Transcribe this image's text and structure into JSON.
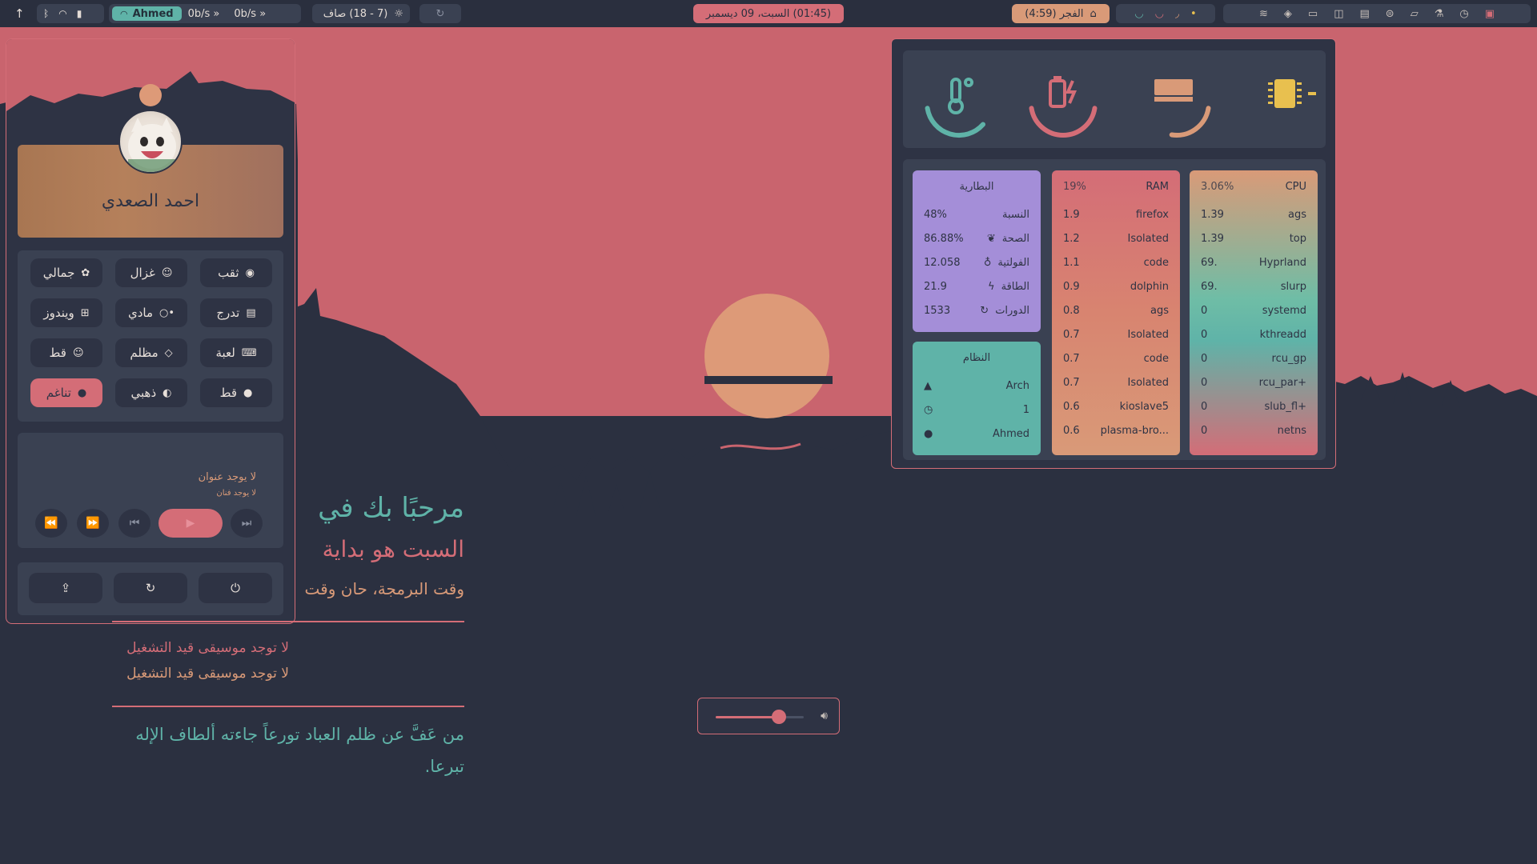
{
  "topbar": {
    "workspace_user": "Ahmed",
    "net_up": "0b/s",
    "net_down": "0b/s",
    "weather": "(7 - 18) صاف",
    "clock": "(01:45) السبت، 09 ديسمبر",
    "prayer": "الفجر (4:59)"
  },
  "profile": {
    "name": "احمد الصعدي"
  },
  "apps": [
    {
      "label": "ثقب",
      "icon": "steam-icon",
      "glyph": "◉"
    },
    {
      "label": "غزال",
      "icon": "ghost-icon",
      "glyph": "☺"
    },
    {
      "label": "جمالي",
      "icon": "palette-icon",
      "glyph": "✿"
    },
    {
      "label": "تدرج",
      "icon": "gradient-icon",
      "glyph": "▤"
    },
    {
      "label": "مادي",
      "icon": "toggle-icon",
      "glyph": "•○"
    },
    {
      "label": "ويندوز",
      "icon": "windows-icon",
      "glyph": "⊞"
    },
    {
      "label": "لعبة",
      "icon": "gamepad-icon",
      "glyph": "⌨"
    },
    {
      "label": "مظلم",
      "icon": "diamond-icon",
      "glyph": "◇"
    },
    {
      "label": "قط",
      "icon": "cat-icon",
      "glyph": "☺"
    },
    {
      "label": "قط",
      "icon": "circle-icon",
      "glyph": "●"
    },
    {
      "label": "ذهبي",
      "icon": "circle-half-icon",
      "glyph": "◐"
    },
    {
      "label": "تناغم",
      "icon": "circle-dot-icon",
      "glyph": "●"
    }
  ],
  "player": {
    "title": "لا يوجد عنوان",
    "artist": "لا يوجد فنان"
  },
  "welcome": {
    "line1": "مرحبًا بك في",
    "line2": "السبت هو بداية",
    "line3": "وقت البرمجة، حان وقت",
    "music1": "لا توجد موسيقى قيد التشغيل",
    "music2": "لا توجد موسيقى قيد التشغيل",
    "quote1": "من عَفَّ عن ظلم العباد تورعاً جاءته ألطاف الإله",
    "quote2": "تبرعا."
  },
  "cpu": {
    "header": "CPU",
    "value": "3.06%",
    "rows": [
      {
        "name": "ags",
        "val": "1.39"
      },
      {
        "name": "top",
        "val": "1.39"
      },
      {
        "name": "Hyprland",
        "val": "69."
      },
      {
        "name": "slurp",
        "val": "69."
      },
      {
        "name": "systemd",
        "val": "0"
      },
      {
        "name": "kthreadd",
        "val": "0"
      },
      {
        "name": "rcu_gp",
        "val": "0"
      },
      {
        "name": "rcu_par+",
        "val": "0"
      },
      {
        "name": "slub_fl+",
        "val": "0"
      },
      {
        "name": "netns",
        "val": "0"
      }
    ]
  },
  "ram": {
    "header": "RAM",
    "value": "19%",
    "rows": [
      {
        "name": "firefox",
        "val": "1.9"
      },
      {
        "name": "Isolated",
        "val": "1.2"
      },
      {
        "name": "code",
        "val": "1.1"
      },
      {
        "name": "dolphin",
        "val": "0.9"
      },
      {
        "name": "ags",
        "val": "0.8"
      },
      {
        "name": "Isolated",
        "val": "0.7"
      },
      {
        "name": "code",
        "val": "0.7"
      },
      {
        "name": "Isolated",
        "val": "0.7"
      },
      {
        "name": "kioslave5",
        "val": "0.6"
      },
      {
        "name": "plasma-bro...",
        "val": "0.6"
      }
    ]
  },
  "battery": {
    "header": "البطارية",
    "rows": [
      {
        "name": "النسبة",
        "val": "48%",
        "glyph": ""
      },
      {
        "name": "الصحة",
        "val": "86.88%",
        "glyph": "❦"
      },
      {
        "name": "الفولتية",
        "val": "12.058",
        "glyph": "♁"
      },
      {
        "name": "الطاقة",
        "val": "21.9",
        "glyph": "ϟ"
      },
      {
        "name": "الدورات",
        "val": "1533",
        "glyph": "↻"
      }
    ]
  },
  "system": {
    "header": "النظام",
    "rows": [
      {
        "val": "Arch",
        "glyph": "▲"
      },
      {
        "val": "1",
        "glyph": "◷"
      },
      {
        "val": "Ahmed",
        "glyph": "●"
      }
    ]
  },
  "gauges": {
    "temp_fraction": 0.45,
    "battery_fraction": 0.48,
    "ram_fraction": 0.19,
    "cpu_fraction": 0.03
  },
  "volume": {
    "level": 0.72
  },
  "colors": {
    "accent_red": "#d46d77",
    "accent_teal": "#5fb3a8",
    "accent_orange": "#d99a78",
    "accent_purple": "#a48ed8"
  }
}
